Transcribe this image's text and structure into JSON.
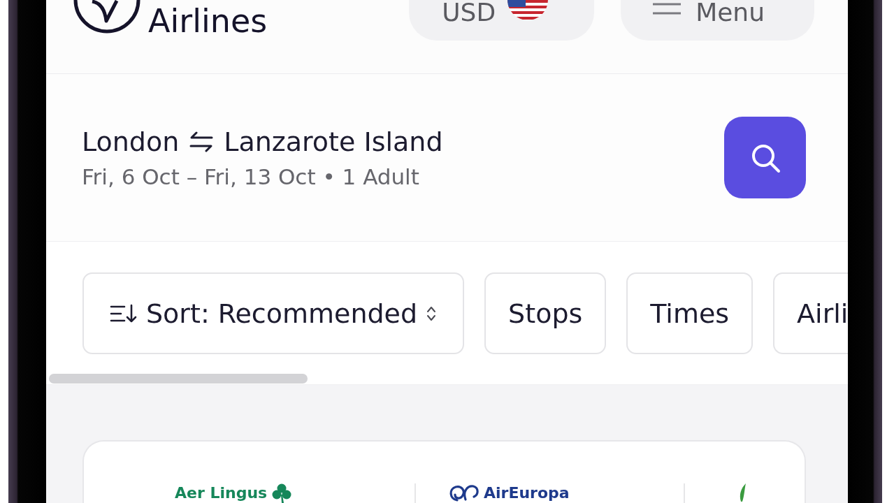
{
  "header": {
    "brand": "Airlines",
    "currency": "USD",
    "menu": "Menu"
  },
  "search_summary": {
    "origin": "London",
    "destination": "Lanzarote Island",
    "details": "Fri, 6 Oct – Fri, 13 Oct • 1 Adult"
  },
  "filters": [
    {
      "kind": "sort",
      "label": "Sort: Recommended"
    },
    {
      "kind": "chip",
      "label": "Stops"
    },
    {
      "kind": "chip",
      "label": "Times"
    },
    {
      "kind": "chip",
      "label": "Airli"
    }
  ],
  "airlines": [
    {
      "kind": "clover",
      "name": "Aer Lingus",
      "color": "#16875a"
    },
    {
      "kind": "swirl",
      "name": "AirEuropa",
      "color": "#1e3a8c"
    },
    {
      "kind": "leaf",
      "color": "#3a9b3f"
    }
  ]
}
